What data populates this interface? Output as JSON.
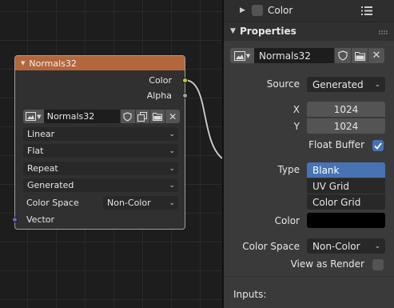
{
  "node": {
    "title": "Normals32",
    "outputs": {
      "color": "Color",
      "alpha": "Alpha"
    },
    "image_name": "Normals32",
    "interpolation": "Linear",
    "projection": "Flat",
    "extension": "Repeat",
    "source": "Generated",
    "color_space_label": "Color Space",
    "color_space_value": "Non-Color",
    "input_vector": "Vector",
    "colors": {
      "header": "#b4663c",
      "color_socket": "#c7c729",
      "alpha_socket": "#a1a1a1",
      "vector_socket": "#6363c7"
    }
  },
  "panel": {
    "color_section": {
      "label": "Color"
    },
    "properties_header": "Properties",
    "image_name": "Normals32",
    "source_label": "Source",
    "source_value": "Generated",
    "x_label": "X",
    "x_value": "1024",
    "y_label": "Y",
    "y_value": "1024",
    "float_buffer_label": "Float Buffer",
    "float_buffer_checked": true,
    "type_label": "Type",
    "type_options": [
      "Blank",
      "UV Grid",
      "Color Grid"
    ],
    "type_selected": "Blank",
    "color_label": "Color",
    "color_swatch": "#000000",
    "color_space_label": "Color Space",
    "color_space_value": "Non-Color",
    "view_as_render_label": "View as Render",
    "inputs_label": "Inputs:",
    "accent": "#4772b3"
  }
}
